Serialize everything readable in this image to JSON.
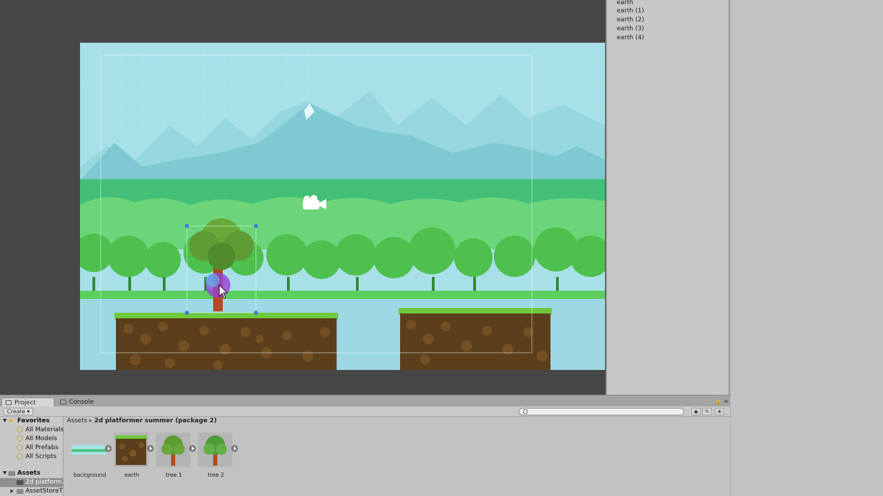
{
  "hierarchy": {
    "items": [
      "earth",
      "earth (1)",
      "earth (2)",
      "earth (3)",
      "earth (4)"
    ]
  },
  "project_panel": {
    "tabs": [
      {
        "label": "Project",
        "active": true
      },
      {
        "label": "Console",
        "active": false
      }
    ],
    "create_label": "Create ▾",
    "breadcrumb": {
      "root": "Assets",
      "separator": "▸",
      "current": "2d platformer summer (package 2)"
    },
    "favorites": {
      "label": "Favorites",
      "items": [
        "All Materials",
        "All Models",
        "All Prefabs",
        "All Scripts"
      ]
    },
    "assets_tree": {
      "label": "Assets",
      "children": [
        "2d platform…",
        "AssetStoreT…"
      ]
    },
    "assets": [
      {
        "label": "background",
        "kind": "background"
      },
      {
        "label": "earth",
        "kind": "earth"
      },
      {
        "label": "tree 1",
        "kind": "tree"
      },
      {
        "label": "tree 2",
        "kind": "tree"
      }
    ]
  },
  "colors": {
    "sky": "#a8e0e8",
    "mountain": "#82ccd6",
    "forest_far": "#4fc37e",
    "forest_mid": "#6ad77a",
    "tree_green": "#4fc24a",
    "water": "#9ed8e4",
    "grass": "#6fc93f",
    "dirt": "#5b3f1c",
    "selection_handle": "#3a7bd5"
  }
}
